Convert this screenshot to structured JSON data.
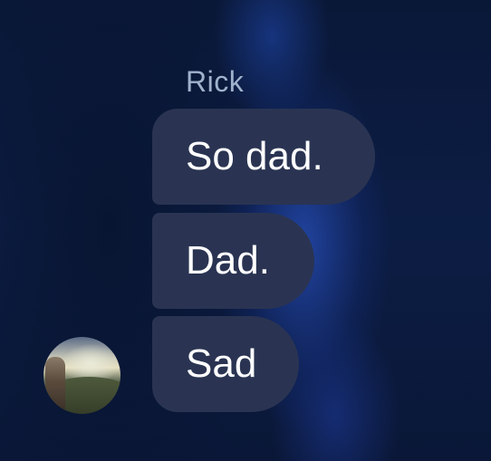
{
  "conversation": {
    "sender_name": "Rick",
    "messages": [
      {
        "text": "So dad."
      },
      {
        "text": "Dad."
      },
      {
        "text": "Sad"
      }
    ]
  },
  "colors": {
    "background": "#0b1a3c",
    "bubble": "#2a3452",
    "bubble_text": "#ffffff",
    "sender_name": "#9fb2cc"
  },
  "icons": {
    "avatar": "sender-avatar-photo"
  }
}
